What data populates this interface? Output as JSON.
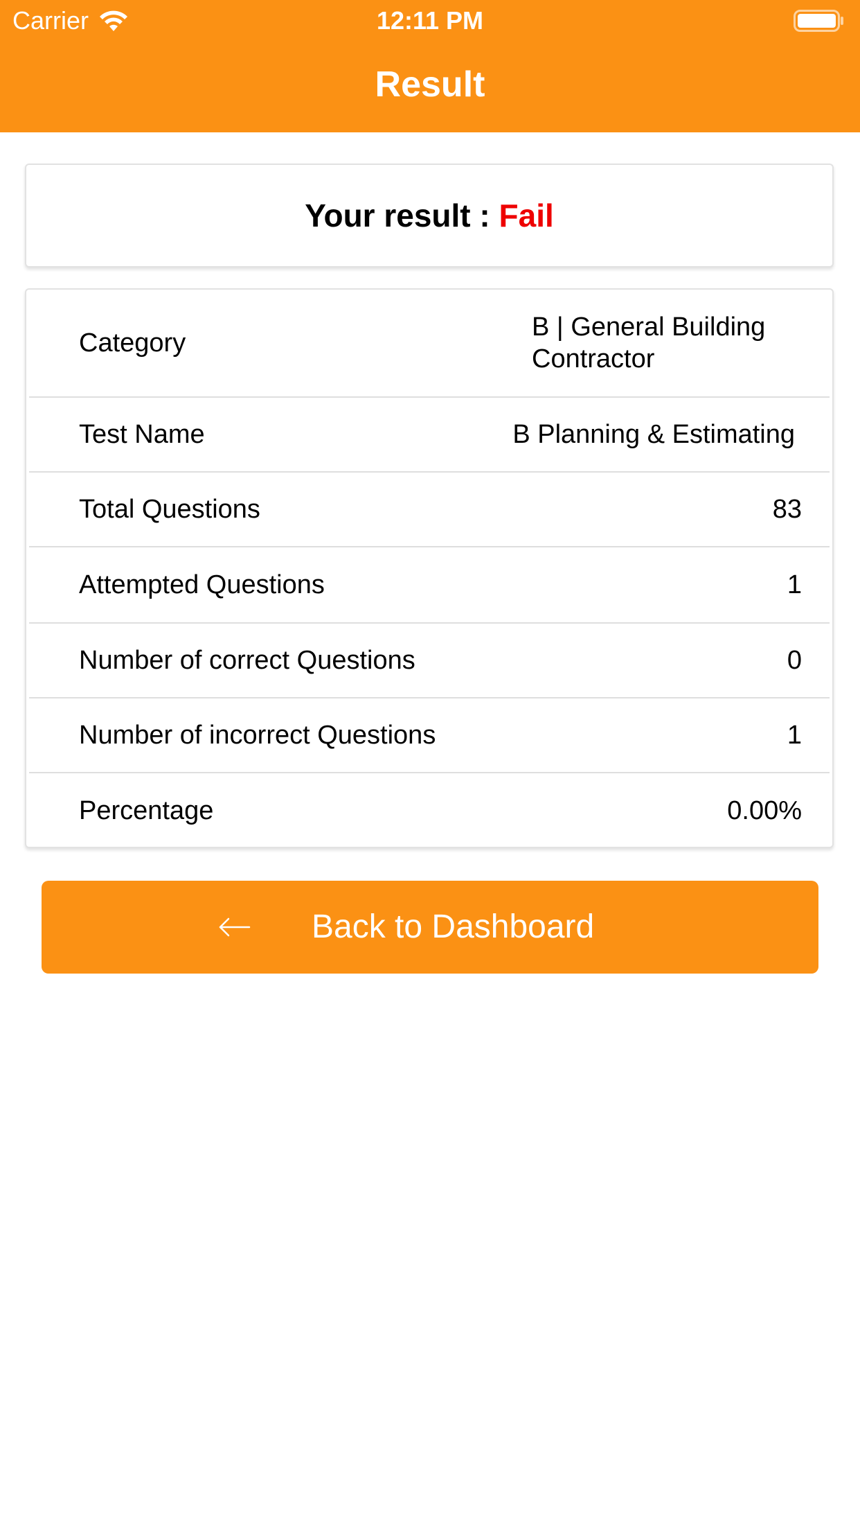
{
  "status_bar": {
    "carrier": "Carrier",
    "time": "12:11 PM",
    "wifi_icon": "wifi-icon",
    "battery_icon": "battery-icon"
  },
  "header": {
    "title": "Result",
    "background_color": "#FB9114"
  },
  "result": {
    "label": "Your result : ",
    "status": "Fail",
    "status_color": "#EE0000"
  },
  "details": {
    "rows": [
      {
        "label": "Category",
        "value": "B | General Building Contractor"
      },
      {
        "label": "Test Name",
        "value": "B Planning & Estimating"
      },
      {
        "label": "Total Questions",
        "value": "83"
      },
      {
        "label": "Attempted Questions",
        "value": "1"
      },
      {
        "label": "Number of correct Questions",
        "value": "0"
      },
      {
        "label": "Number of incorrect Questions",
        "value": "1"
      },
      {
        "label": "Percentage",
        "value": "0.00%"
      }
    ]
  },
  "actions": {
    "back_label": "Back to Dashboard",
    "back_icon": "arrow-left-icon",
    "button_color": "#FB9114"
  }
}
